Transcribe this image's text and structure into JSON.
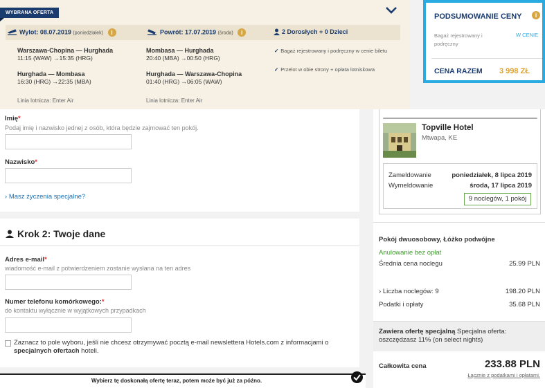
{
  "offer": {
    "tag": "WYBRANA OFERTA",
    "outbound_header": "Wylot: 08.07.2019",
    "outbound_day": "(poniedziałek)",
    "return_header": "Powrót: 17.07.2019",
    "return_day": "(środa)",
    "travellers": "2 Dorosłych + 0 Dzieci",
    "outbound_leg1_route": "Warszawa-Chopina — Hurghada",
    "outbound_leg1_time": "11:15 (WAW) →15:35 (HRG)",
    "outbound_leg2_route": "Hurghada — Mombasa",
    "outbound_leg2_time": "16:30 (HRG) →22:35 (MBA)",
    "outbound_airline": "Linia lotnicza: Enter Air",
    "return_leg1_route": "Mombasa — Hurghada",
    "return_leg1_time": "20:40 (MBA) →00:50 (HRG)",
    "return_leg2_route": "Hurghada — Warszawa-Chopina",
    "return_leg2_time": "01:40 (HRG) →06:05 (WAW)",
    "return_airline": "Linia lotnicza: Enter Air",
    "included1": "Bagaż rejestrowany i podręczny w cenie biletu",
    "included2": "Przelot w obie strony + opłata lotniskowa"
  },
  "summary": {
    "title": "PODSUMOWANIE CENY",
    "baggage_label": "Bagaż rejestrowany i podręczny",
    "baggage_value": "W CENIE",
    "total_label": "CENA RAZEM",
    "total_value": "3 998 ZŁ"
  },
  "form": {
    "first_name_label": "Imię",
    "first_name_hint": "Podaj imię i nazwisko jednej z osób, która będzie zajmować ten pokój.",
    "last_name_label": "Nazwisko",
    "special_requests_link": "Masz życzenia specjalne?",
    "step2_title": "Krok 2: Twoje dane",
    "email_label": "Adres e-mail",
    "email_hint": "wiadomość e-mail z potwierdzeniem zostanie wysłana na ten adres",
    "phone_label": "Numer telefonu komórkowego:",
    "phone_hint": "do kontaktu wyłącznie w wyjątkowych przypadkach",
    "newsletter_text": "Zaznacz to pole wyboru, jeśli nie chcesz otrzymywać pocztą e-mail newslettera Hotels.com z informacjami o",
    "newsletter_bold": "specjalnych ofertach",
    "newsletter_tail": "hoteli.",
    "required_mark": "*"
  },
  "hotel": {
    "name": "Topville Hotel",
    "location": "Mtwapa, KE",
    "checkin_label": "Zameldowanie",
    "checkin_value": "poniedziałek, 8 lipca 2019",
    "checkout_label": "Wymeldowanie",
    "checkout_value": "środa, 17 lipca 2019",
    "nights": "9 noclegów, 1 pokój",
    "room_type": "Pokój dwuosobowy, Łóżko podwójne",
    "cancellation": "Anulowanie bez opłat",
    "avg_label": "Średnia cena noclegu",
    "avg_value": "25.99 PLN",
    "nights_link": "Liczba noclegów: 9",
    "nights_value": "198.20 PLN",
    "taxes_label": "Podatki i opłaty",
    "taxes_value": "35.68 PLN",
    "special_bold": "Zawiera ofertę specjalną",
    "special_text": "Specjalna oferta: oszczędzasz 11% (on select nights)",
    "total_label": "Całkowita cena",
    "total_value": "233.88 PLN",
    "total_note": "Łącznie z podatkami i opłatami."
  },
  "banner": {
    "text": "Wybierz tę doskonałą ofertę teraz, potem może być już za późno."
  },
  "colors": {
    "navy": "#1a3b6e",
    "accent_blue": "#29abe2",
    "gold": "#e0a020",
    "green": "#3c9a2a"
  },
  "icons": [
    "plane-departure-icon",
    "plane-arrival-icon",
    "people-icon",
    "info-icon",
    "chevron-down-icon",
    "check-icon",
    "user-icon",
    "check-circle-icon"
  ]
}
